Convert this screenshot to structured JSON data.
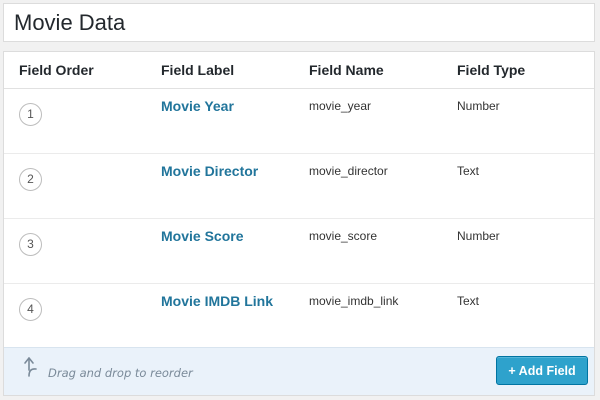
{
  "header": {
    "title": "Movie Data"
  },
  "table": {
    "columns": [
      "Field Order",
      "Field Label",
      "Field Name",
      "Field Type"
    ],
    "rows": [
      {
        "order": "1",
        "label": "Movie Year",
        "name": "movie_year",
        "type": "Number"
      },
      {
        "order": "2",
        "label": "Movie Director",
        "name": "movie_director",
        "type": "Text"
      },
      {
        "order": "3",
        "label": "Movie Score",
        "name": "movie_score",
        "type": "Number"
      },
      {
        "order": "4",
        "label": "Movie IMDB Link",
        "name": "movie_imdb_link",
        "type": "Text"
      }
    ]
  },
  "footer": {
    "drag_text": "Drag and drop to reorder",
    "add_button": "+ Add Field",
    "drag_icon": "curved-arrow-up-icon"
  },
  "colors": {
    "link": "#21759b",
    "button": "#2ea2cc",
    "footer_bg": "#eaf2fa"
  }
}
